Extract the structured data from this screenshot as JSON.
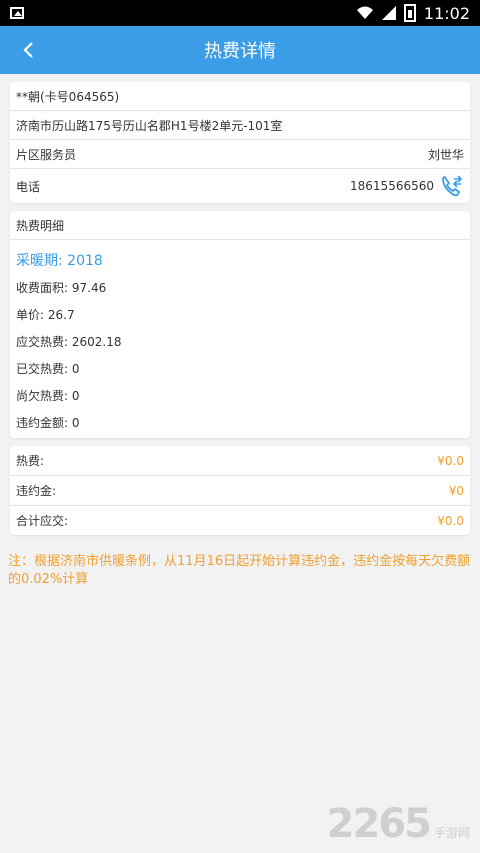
{
  "status_bar": {
    "time": "11:02"
  },
  "header": {
    "title": "热费详情"
  },
  "account": {
    "name": "**朝(卡号064565)",
    "address": "济南市历山路175号历山名郡H1号楼2单元-101室",
    "service_label": "片区服务员",
    "service_name": "刘世华",
    "phone_label": "电话",
    "phone_number": "18615566560"
  },
  "detail": {
    "heading": "热费明细",
    "season": "采暖期: 2018",
    "lines": [
      "收费面积: 97.46",
      "单价: 26.7",
      "应交热费: 2602.18",
      "已交热费: 0",
      "尚欠热费: 0",
      "违约金额: 0"
    ]
  },
  "fees": [
    {
      "label": "热费:",
      "amount": "¥0.0"
    },
    {
      "label": "违约金:",
      "amount": "¥0"
    },
    {
      "label": "合计应交:",
      "amount": "¥0.0"
    }
  ],
  "note": "注：根据济南市供暖条例，从11月16日起开始计算违约金，违约金按每天欠费额的0.02%计算",
  "watermark": {
    "number": "2265",
    "text": "手游网"
  },
  "colors": {
    "primary": "#3a9de5",
    "accent": "#f0a030"
  }
}
